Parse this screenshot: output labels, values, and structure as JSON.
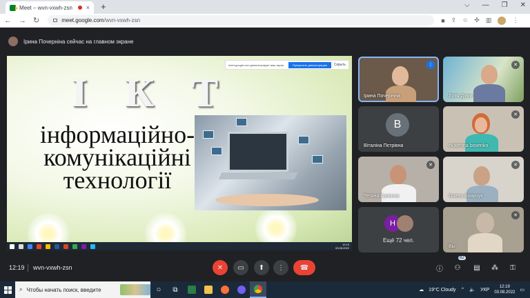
{
  "browser": {
    "tab_title": "Meet – wvn-vxwh-zsn",
    "tab_close": "×",
    "new_tab": "+",
    "window_controls": [
      "⌵",
      "—",
      "❐",
      "✕"
    ],
    "url_host": "meet.google.com",
    "url_path": "/wvn-vxwh-zsn"
  },
  "meet": {
    "presenter_notice": "Ірина Почерніна сейчас на главном экране",
    "slide": {
      "title": "І К Т",
      "subtitle": "інформаційно-комунікаційні технології",
      "notif_text": "meet.google.com демонстрирует ваш экран",
      "notif_button": "Прекратить демонстрацию",
      "notif_close": "Скрыть",
      "clock_time": "12:19",
      "clock_date": "03.08.2022"
    },
    "participants": [
      {
        "name": "Ірина Почерніна",
        "state": "speaking"
      },
      {
        "name": "Лілія Думи",
        "state": "muted"
      },
      {
        "name": "Віталіна Пєтрівна",
        "state": "avatar",
        "initial": "В"
      },
      {
        "name": "ekaterina bosenko",
        "state": "muted"
      },
      {
        "name": "Тетяна Гуменна",
        "state": "muted"
      },
      {
        "name": "Олена Боярчук",
        "state": "muted"
      },
      {
        "name": "Вы",
        "state": "muted"
      }
    ],
    "more": {
      "label": "Ещё 72 чел.",
      "initial": "Н"
    },
    "controls": {
      "time": "12:19",
      "meeting_code": "wvn-vxwh-zsn",
      "people_count": "82"
    }
  },
  "taskbar": {
    "search_placeholder": "Чтобы начать поиск, введите",
    "weather": "19°C Cloudy",
    "lang": "УКР",
    "time": "12:19",
    "date": "03.08.2022"
  },
  "colors": {
    "meet_bg": "#202124",
    "end_call": "#ea4335",
    "active_outline": "#8ab4f8",
    "taskbar_bg": "#1b2a3a"
  }
}
